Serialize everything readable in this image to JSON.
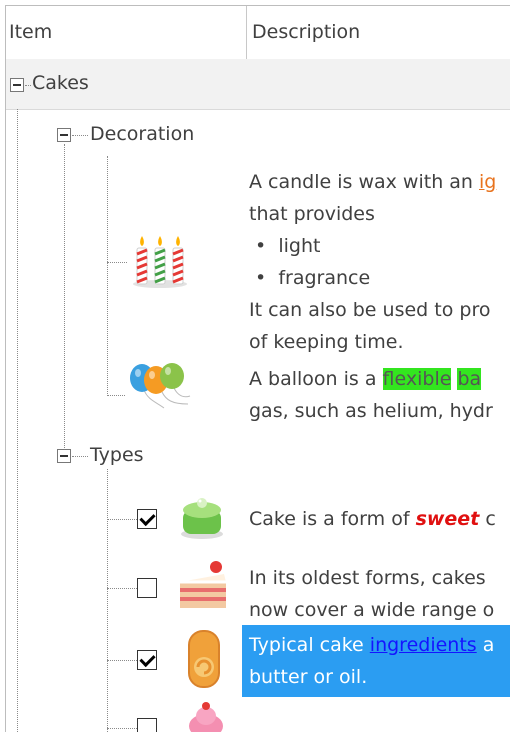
{
  "header": {
    "item": "Item",
    "description": "Description"
  },
  "tree": {
    "root": "Cakes",
    "decoration": {
      "label": "Decoration",
      "candle": {
        "icon": "candles-icon",
        "line1_pre": "A candle is wax with an ",
        "line1_hl": "ig",
        "line2": "that provides",
        "bullet1": "light",
        "bullet2": "fragrance",
        "line5": "It can also be used to pro",
        "line6": "of keeping time."
      },
      "balloon": {
        "icon": "balloons-icon",
        "line1_pre": "A balloon is a ",
        "line1_hl1": "flexible",
        "line1_hl2": "ba",
        "line2": "gas, such as helium, hydr"
      }
    },
    "types": {
      "label": "Types",
      "items": [
        {
          "icon": "green-cake-icon",
          "checked": true,
          "pre": "Cake is a form of ",
          "em": "sweet",
          "post": " c"
        },
        {
          "icon": "cake-slice-icon",
          "checked": false,
          "line1": "In its oldest forms, cakes",
          "line2": "now cover a wide range o"
        },
        {
          "icon": "swiss-roll-icon",
          "checked": true,
          "pre": "Typical cake ",
          "link": "ingredients",
          "post": " a",
          "line2": "butter or oil."
        },
        {
          "icon": "cupcake-icon",
          "checked": false
        }
      ]
    }
  },
  "colors": {
    "selection": "#2b9df2",
    "highlight_green": "#33e51f",
    "accent_orange": "#e8731e",
    "emphasis_red": "#e01010"
  }
}
